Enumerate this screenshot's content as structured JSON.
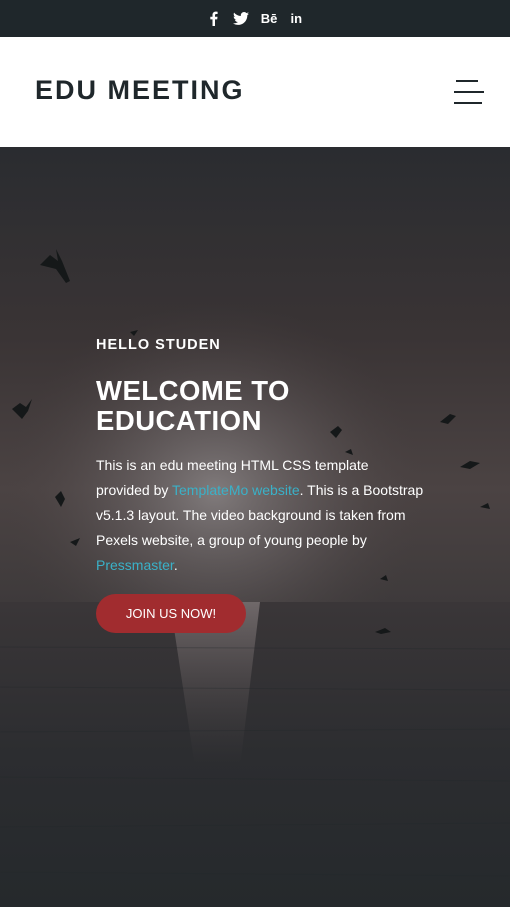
{
  "social": {
    "facebook_icon": "facebook-icon",
    "twitter_icon": "twitter-icon",
    "behance_label": "Bē",
    "linkedin_label": "in"
  },
  "header": {
    "logo": "EDU MEETING",
    "menu_icon": "hamburger-menu-icon"
  },
  "hero": {
    "kicker": "HELLO STUDEN",
    "headline_line1": "WELCOME TO",
    "headline_line2": "EDUCATION",
    "desc_part1": "This is an edu meeting HTML CSS template provided by ",
    "desc_link1": "TemplateMo website",
    "desc_part2": ". This is a Bootstrap v5.1.3 layout. The video background is taken from Pexels website, a group of young people by ",
    "desc_link2": "Pressmaster",
    "desc_part3": ".",
    "cta_label": "JOIN US NOW!"
  },
  "colors": {
    "topbar": "#1f272b",
    "header_bg": "#ffffff",
    "accent_button": "#a12c2f",
    "link": "#3ab1c8"
  }
}
